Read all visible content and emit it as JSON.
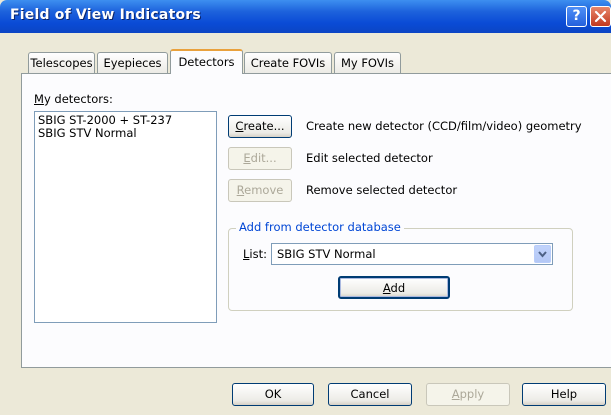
{
  "window": {
    "title": "Field of View Indicators",
    "help_glyph": "?",
    "close_glyph": "✕"
  },
  "tabs": [
    {
      "label": "Telescopes"
    },
    {
      "label": "Eyepieces"
    },
    {
      "label": "Detectors"
    },
    {
      "label": "Create FOVIs"
    },
    {
      "label": "My FOVIs"
    }
  ],
  "active_tab": "Detectors",
  "detectors": {
    "label_mnemonic": "M",
    "label_rest": "y detectors:",
    "items": [
      "SBIG ST-2000 + ST-237",
      "SBIG STV Normal"
    ]
  },
  "actions": {
    "create": {
      "label": "Create...",
      "mnemonic": "C",
      "rest": "reate...",
      "description": "Create new detector (CCD/film/video) geometry",
      "enabled": true
    },
    "edit": {
      "label": "Edit...",
      "mnemonic": "E",
      "rest": "dit...",
      "description": "Edit selected detector",
      "enabled": false
    },
    "remove": {
      "label": "Remove",
      "mnemonic": "R",
      "rest": "emove",
      "description": "Remove selected detector",
      "enabled": false
    }
  },
  "database": {
    "group_title": "Add from detector database",
    "list_label_mnemonic": "L",
    "list_label_rest": "ist:",
    "selected": "SBIG STV Normal",
    "add_mnemonic": "A",
    "add_rest": "dd"
  },
  "footer": {
    "ok": "OK",
    "cancel": "Cancel",
    "apply_mnemonic": "A",
    "apply_rest": "pply",
    "apply_enabled": false,
    "help": "Help"
  },
  "colors": {
    "titlebar": "#0a4bd6",
    "dialog_bg": "#ece9d8",
    "panel_bg": "#fcfcfe",
    "active_tab_accent": "#e9a13d",
    "group_title": "#0046d5"
  }
}
